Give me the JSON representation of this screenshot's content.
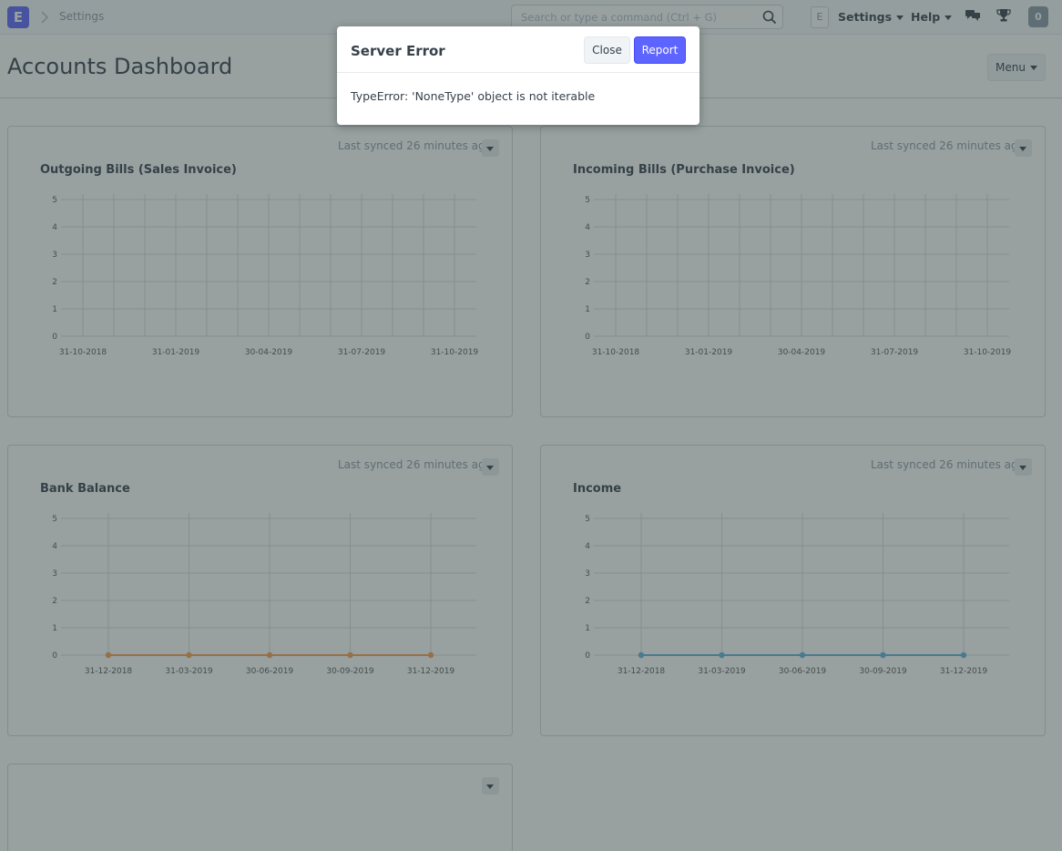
{
  "navbar": {
    "logo_letter": "E",
    "breadcrumb": "Settings",
    "search_placeholder": "Search or type a command (Ctrl + G)",
    "avatar_letter": "E",
    "settings_label": "Settings",
    "help_label": "Help",
    "notification_count": "0"
  },
  "page": {
    "title": "Accounts Dashboard",
    "menu_label": "Menu"
  },
  "cards": [
    {
      "title": "Outgoing Bills (Sales Invoice)",
      "synced": "Last synced 26 minutes ago",
      "chart_data": {
        "type": "line",
        "title": "Outgoing Bills (Sales Invoice)",
        "x_tick_labels": [
          "31-10-2018",
          "31-01-2019",
          "30-04-2019",
          "31-07-2019",
          "31-10-2019"
        ],
        "y_ticks": [
          0,
          1,
          2,
          3,
          4,
          5
        ],
        "ylim": [
          0,
          5
        ],
        "vertical_gridlines": 13,
        "series": []
      }
    },
    {
      "title": "Incoming Bills (Purchase Invoice)",
      "synced": "Last synced 26 minutes ago",
      "chart_data": {
        "type": "line",
        "title": "Incoming Bills (Purchase Invoice)",
        "x_tick_labels": [
          "31-10-2018",
          "31-01-2019",
          "30-04-2019",
          "31-07-2019",
          "31-10-2019"
        ],
        "y_ticks": [
          0,
          1,
          2,
          3,
          4,
          5
        ],
        "ylim": [
          0,
          5
        ],
        "vertical_gridlines": 13,
        "series": []
      }
    },
    {
      "title": "Bank Balance",
      "synced": "Last synced 26 minutes ago",
      "chart_data": {
        "type": "line",
        "title": "Bank Balance",
        "x_tick_labels": [
          "31-12-2018",
          "31-03-2019",
          "30-06-2019",
          "30-09-2019",
          "31-12-2019"
        ],
        "y_ticks": [
          0,
          1,
          2,
          3,
          4,
          5
        ],
        "ylim": [
          0,
          5
        ],
        "vertical_gridlines": 5,
        "series": [
          {
            "values": [
              0,
              0,
              0,
              0,
              0
            ],
            "color": "#f8a050"
          }
        ]
      }
    },
    {
      "title": "Income",
      "synced": "Last synced 26 minutes ago",
      "chart_data": {
        "type": "line",
        "title": "Income",
        "x_tick_labels": [
          "31-12-2018",
          "31-03-2019",
          "30-06-2019",
          "30-09-2019",
          "31-12-2019"
        ],
        "y_ticks": [
          0,
          1,
          2,
          3,
          4,
          5
        ],
        "ylim": [
          0,
          5
        ],
        "vertical_gridlines": 5,
        "series": [
          {
            "values": [
              0,
              0,
              0,
              0,
              0
            ],
            "color": "#5fb5dc"
          }
        ]
      }
    }
  ],
  "modal": {
    "title": "Server Error",
    "close_label": "Close",
    "report_label": "Report",
    "message": "TypeError: 'NoneType' object is not iterable"
  },
  "colors": {
    "primary": "#5e64ff",
    "backdrop": "rgba(50, 66, 66, 0.5)"
  }
}
